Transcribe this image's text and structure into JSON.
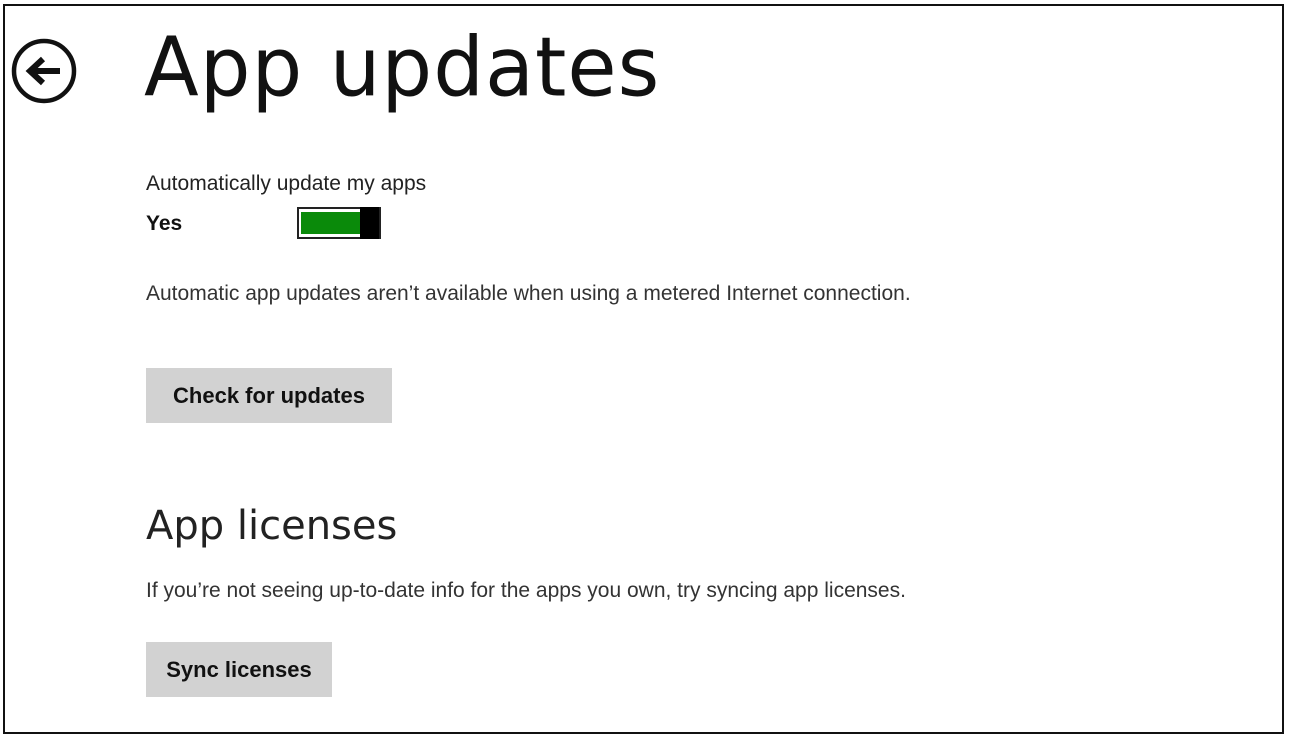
{
  "header": {
    "title": "App updates",
    "back_icon": "arrow-left-circle-icon"
  },
  "auto_update": {
    "label": "Automatically update my apps",
    "value_label": "Yes",
    "enabled": true,
    "toggle_on_color": "#0a8a0a",
    "note": "Automatic app updates aren’t available when using a metered Internet connection."
  },
  "actions": {
    "check_updates_label": "Check for updates"
  },
  "licenses": {
    "title": "App licenses",
    "description": "If you’re not seeing up-to-date info for the apps you own, try syncing app licenses.",
    "sync_label": "Sync licenses"
  }
}
